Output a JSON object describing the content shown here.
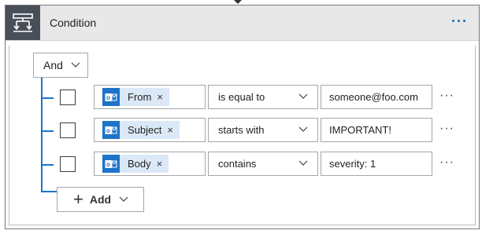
{
  "header": {
    "title": "Condition",
    "more_icon": "ellipsis-icon",
    "more_label": "···"
  },
  "logic": {
    "operator": "And"
  },
  "rows": [
    {
      "field": "From",
      "operator": "is equal to",
      "value": "someone@foo.com"
    },
    {
      "field": "Subject",
      "operator": "starts with",
      "value": "IMPORTANT!"
    },
    {
      "field": "Body",
      "operator": "contains",
      "value": "severity: 1"
    }
  ],
  "row_more_label": "···",
  "token_remove_label": "×",
  "add": {
    "label": "Add",
    "plus": "+"
  },
  "icons": {
    "condition": "condition-icon",
    "outlook": "outlook-icon",
    "chevron": "chevron-down-icon"
  },
  "colors": {
    "accent": "#1a73c8",
    "header_bg": "#e8e8e8",
    "icon_box": "#484f58",
    "token_bg": "#dbe8f7"
  }
}
